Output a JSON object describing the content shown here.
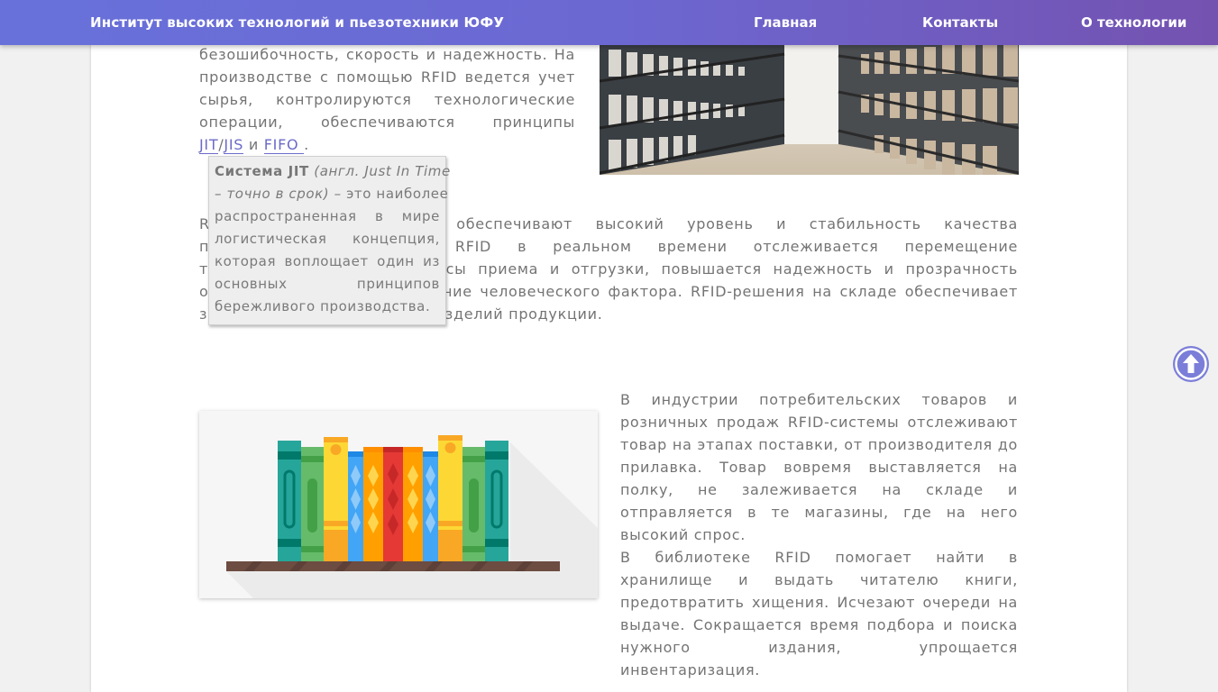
{
  "header": {
    "site_title": "Институт высоких технологий и пьезотехники ЮФУ",
    "nav": [
      "Главная",
      "Контакты",
      "О технологии"
    ]
  },
  "intro": {
    "lines": [
      "безошибочность, скорость и надежность. На",
      "производстве с помощью RFID ведется учет",
      "сырья, контролируются технологические",
      "операции, обеспечиваются принципы"
    ],
    "link_jit": "JIT",
    "slash": "/",
    "link_jis": "JIS",
    "and": " и ",
    "link_fifo": "FIFO ",
    "period": "."
  },
  "tooltip": {
    "term": "Система JIT",
    "italic_1": "(англ. Just In Time",
    "italic_2": "– точно в срок)",
    "rest_1": " – это наиболее",
    "line_3": "распространенная в мире",
    "line_4": "логистическая концепция,",
    "line_5": "которая воплощает один из",
    "line_6": "основных принципов",
    "line_7": "бережливого производства."
  },
  "warehouse": {
    "lines": [
      "RFID-системы на складе обеспечивают высокий уровень и стабильность качества",
      "процессов. С помощью RFID в реальном времени отслеживается перемещение",
      "товаров, ускоряются процессы приема и отгрузки, повышается надежность и прозрачность",
      "операций, исключается влияние человеческого фактора. RFID-решения на складе обеспечивает",
      "защиту от краж и подделок изделий продукции."
    ]
  },
  "retail": {
    "lines": [
      "В индустрии потребительских товаров и",
      "розничных продаж RFID-системы отслеживают",
      "товар на этапах поставки, от производителя до",
      "прилавка. Товар вовремя выставляется на",
      "полку, не залеживается на складе и",
      "отправляется в те магазины, где на него",
      "высокий спрос."
    ]
  },
  "library": {
    "lines": [
      "В библиотеке RFID помогает найти в",
      "хранилище и выдать читателю книги,",
      "предотвратить хищения. Исчезают очереди на",
      "выдаче. Сокращается время подбора и поиска",
      "нужного издания, упрощается",
      "инвентаризация."
    ]
  },
  "colors": {
    "header_start": "#6871da",
    "header_end": "#7452b0",
    "link": "#6b6ac8",
    "up_button": "#7b7ed8"
  },
  "icons": [
    "arrow-up-circle-icon"
  ]
}
